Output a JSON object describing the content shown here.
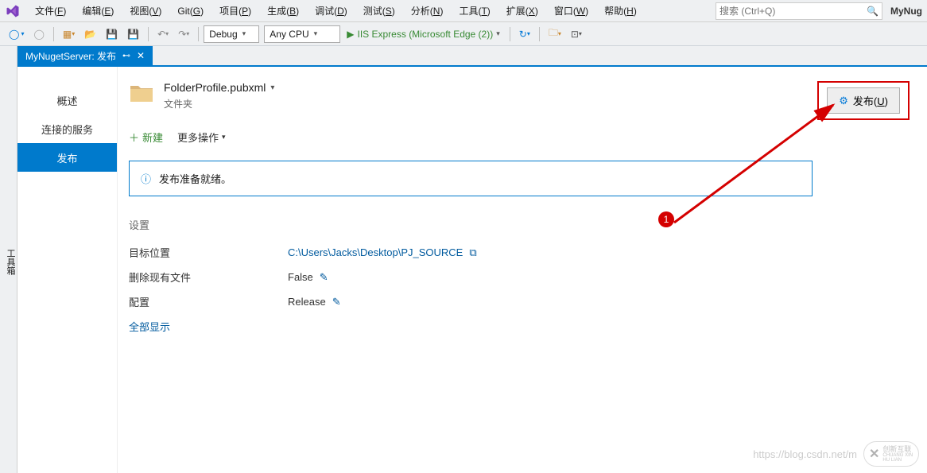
{
  "menubar": {
    "items": [
      {
        "label": "文件(F)",
        "u": "F"
      },
      {
        "label": "编辑(E)",
        "u": "E"
      },
      {
        "label": "视图(V)",
        "u": "V"
      },
      {
        "label": "Git(G)",
        "u": "G"
      },
      {
        "label": "项目(P)",
        "u": "P"
      },
      {
        "label": "生成(B)",
        "u": "B"
      },
      {
        "label": "调试(D)",
        "u": "D"
      },
      {
        "label": "测试(S)",
        "u": "S"
      },
      {
        "label": "分析(N)",
        "u": "N"
      },
      {
        "label": "工具(T)",
        "u": "T"
      },
      {
        "label": "扩展(X)",
        "u": "X"
      },
      {
        "label": "窗口(W)",
        "u": "W"
      },
      {
        "label": "帮助(H)",
        "u": "H"
      }
    ],
    "search_placeholder": "搜索 (Ctrl+Q)",
    "solution": "MyNug"
  },
  "toolbar": {
    "config": "Debug",
    "platform": "Any CPU",
    "run_label": "IIS Express (Microsoft Edge (2))"
  },
  "side_strip": "工具箱",
  "doc_tab": {
    "title": "MyNugetServer: 发布"
  },
  "left_nav": {
    "items": [
      "概述",
      "连接的服务",
      "发布"
    ],
    "active": 2
  },
  "profile": {
    "name": "FolderProfile.pubxml",
    "sub": "文件夹"
  },
  "publish_btn": "发布(U)",
  "actions": {
    "new": "新建",
    "more": "更多操作"
  },
  "status": "发布准备就绪。",
  "settings": {
    "title": "设置",
    "rows": [
      {
        "label": "目标位置",
        "value": "C:\\Users\\Jacks\\Desktop\\PJ_SOURCE",
        "link": true,
        "copy": true
      },
      {
        "label": "删除现有文件",
        "value": "False",
        "edit": true
      },
      {
        "label": "配置",
        "value": "Release",
        "edit": true
      }
    ],
    "show_all": "全部显示"
  },
  "badge": "1",
  "watermark": {
    "url": "https://blog.csdn.net/m",
    "brand": "创新互联",
    "sub": "CHUANG XIN HU LIAN"
  }
}
